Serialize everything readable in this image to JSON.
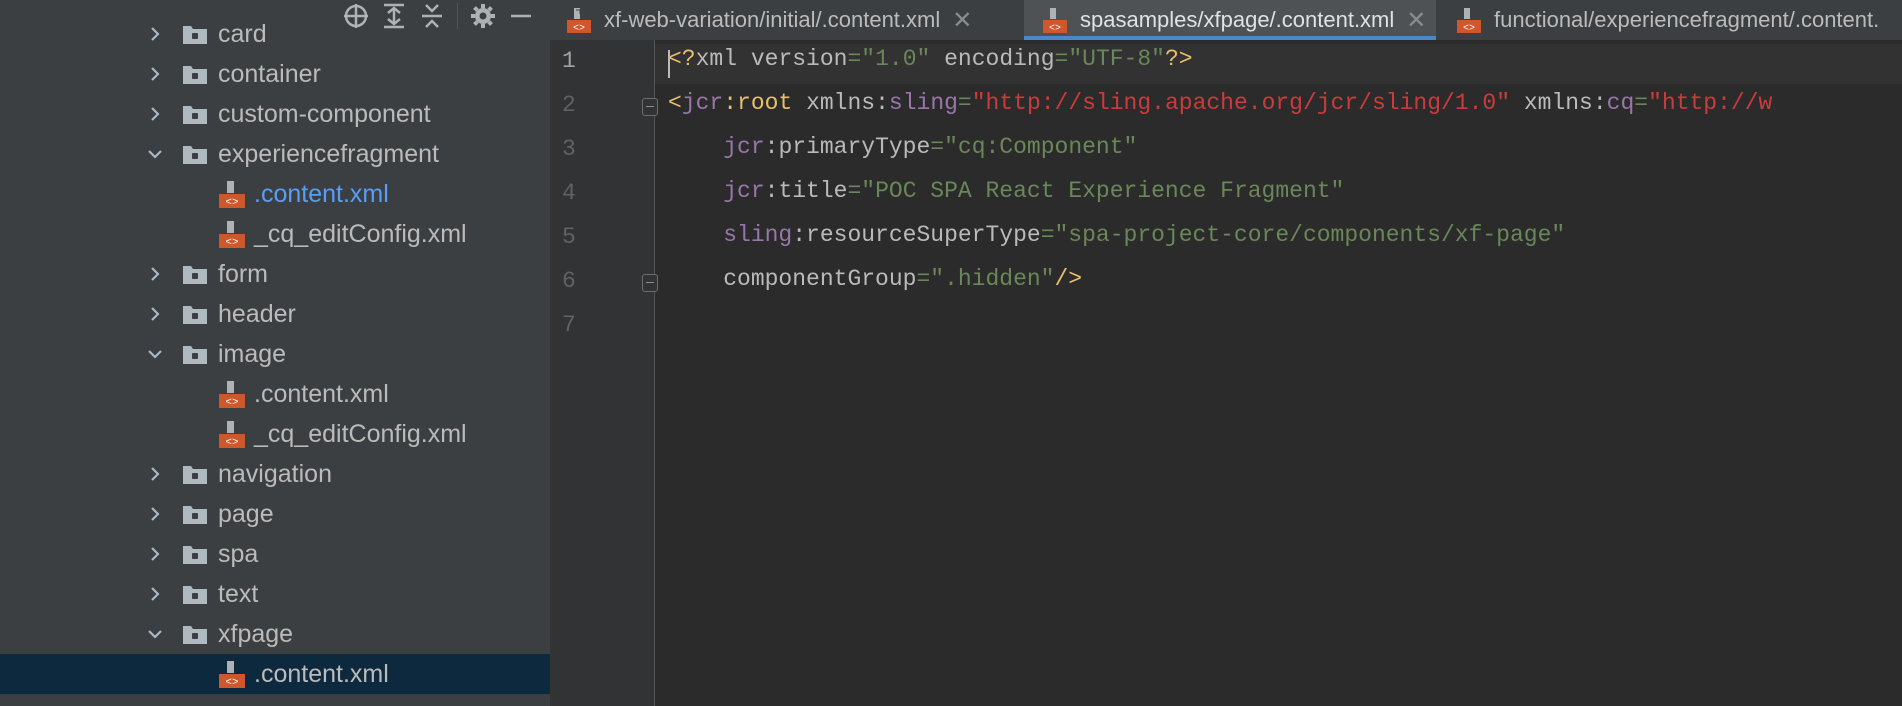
{
  "sidebar": {
    "toolbar_icons": [
      "locate-icon",
      "expand-all-icon",
      "collapse-all-icon",
      "gear-icon",
      "hide-icon"
    ],
    "items": [
      {
        "label": "card",
        "type": "folder",
        "expanded": false
      },
      {
        "label": "container",
        "type": "folder",
        "expanded": false
      },
      {
        "label": "custom-component",
        "type": "folder",
        "expanded": false
      },
      {
        "label": "experiencefragment",
        "type": "folder",
        "expanded": true
      },
      {
        "label": ".content.xml",
        "type": "xml",
        "active": true
      },
      {
        "label": "_cq_editConfig.xml",
        "type": "xml"
      },
      {
        "label": "form",
        "type": "folder",
        "expanded": false
      },
      {
        "label": "header",
        "type": "folder",
        "expanded": false
      },
      {
        "label": "image",
        "type": "folder",
        "expanded": true
      },
      {
        "label": ".content.xml",
        "type": "xml"
      },
      {
        "label": "_cq_editConfig.xml",
        "type": "xml"
      },
      {
        "label": "navigation",
        "type": "folder",
        "expanded": false
      },
      {
        "label": "page",
        "type": "folder",
        "expanded": false
      },
      {
        "label": "spa",
        "type": "folder",
        "expanded": false
      },
      {
        "label": "text",
        "type": "folder",
        "expanded": false
      },
      {
        "label": "xfpage",
        "type": "folder",
        "expanded": true
      },
      {
        "label": ".content.xml",
        "type": "xml",
        "selected": true
      }
    ]
  },
  "tabs": [
    {
      "label": "xf-web-variation/initial/.content.xml",
      "active": false
    },
    {
      "label": "spasamples/xfpage/.content.xml",
      "active": true
    },
    {
      "label": "functional/experiencefragment/.content."
    }
  ],
  "tab_close_symbol": "✕",
  "editor": {
    "current_line": 1,
    "lines": [
      {
        "num": "1",
        "text": "<?xml version=\"1.0\" encoding=\"UTF-8\"?>"
      },
      {
        "num": "2",
        "text": "<jcr:root xmlns:sling=\"http://sling.apache.org/jcr/sling/1.0\" xmlns:cq=\"http://w"
      },
      {
        "num": "3",
        "text": "    jcr:primaryType=\"cq:Component\""
      },
      {
        "num": "4",
        "text": "    jcr:title=\"POC SPA React Experience Fragment\""
      },
      {
        "num": "5",
        "text": "    sling:resourceSuperType=\"spa-project-core/components/xf-page\""
      },
      {
        "num": "6",
        "text": "    componentGroup=\".hidden\"/>"
      },
      {
        "num": "7",
        "text": ""
      }
    ],
    "tokens": {
      "xml_decl_open": "<?",
      "xml_decl_name": "xml",
      "version_attr": "version",
      "version_val": "\"1.0\"",
      "encoding_attr": "encoding",
      "encoding_val": "\"UTF-8\"",
      "xml_decl_close": "?>",
      "root_open": "<",
      "jcr_ns": "jcr",
      "root_name": "root",
      "xmlns": "xmlns",
      "sling_ns": "sling",
      "sling_url": "\"http://sling.apache.org/jcr/sling/1.0\"",
      "cq_ns": "cq",
      "cq_url": "\"http://w",
      "primaryType_attr": "primaryType",
      "primaryType_val": "\"cq:Component\"",
      "title_attr": "title",
      "title_val": "\"POC SPA React Experience Fragment\"",
      "rst_attr": "resourceSuperType",
      "rst_val": "\"spa-project-core/components/xf-page\"",
      "cg_attr": "componentGroup",
      "cg_val": "\".hidden\"",
      "self_close": "/>"
    }
  },
  "colors": {
    "sidebar_bg": "#3c3f41",
    "editor_bg": "#2b2b2b",
    "selection_bg": "#0d293e",
    "accent_blue": "#4a88c7",
    "xml_icon_orange": "#d0562c"
  }
}
